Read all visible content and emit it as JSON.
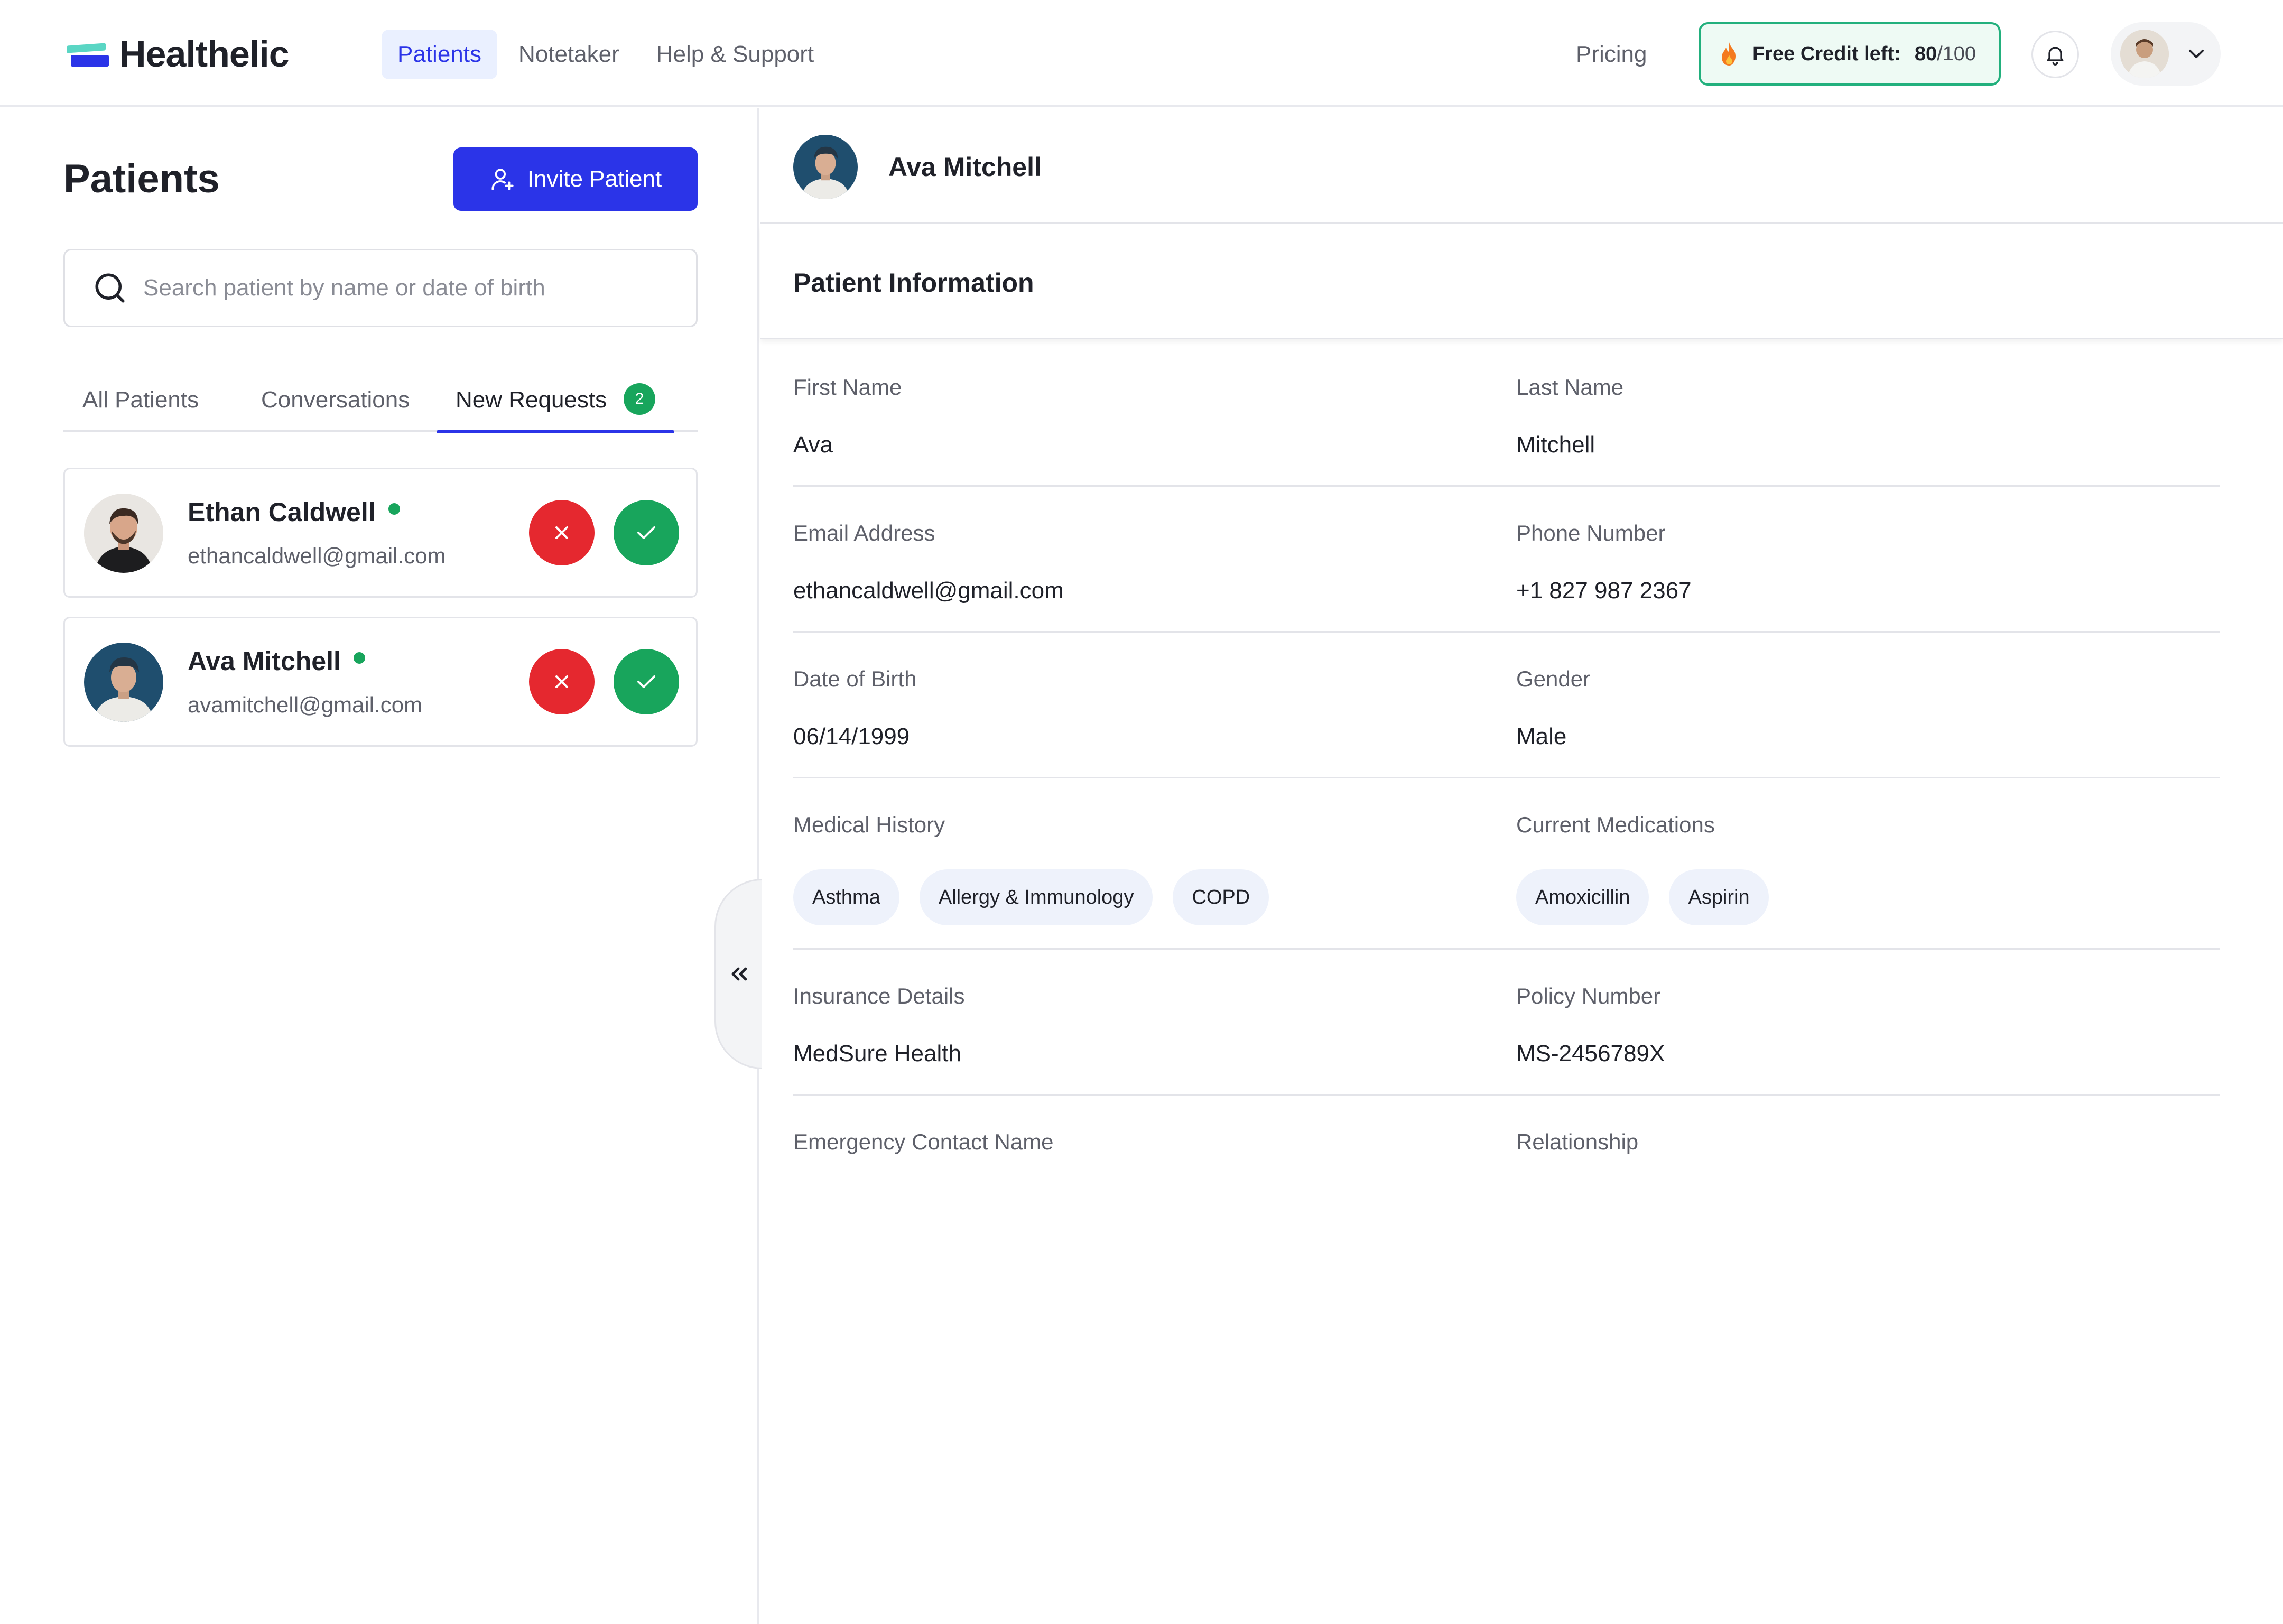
{
  "header": {
    "brand": "Healthelic",
    "nav": [
      {
        "label": "Patients",
        "active": true
      },
      {
        "label": "Notetaker",
        "active": false
      },
      {
        "label": "Help & Support",
        "active": false
      }
    ],
    "pricing": "Pricing",
    "credit": {
      "label": "Free Credit left:",
      "used": "80",
      "total": "/100"
    },
    "icons": {
      "bell": "bell-icon",
      "fire": "fire-icon",
      "chevron": "chevron-down-icon"
    }
  },
  "patients_panel": {
    "title": "Patients",
    "invite_label": "Invite Patient",
    "search_placeholder": "Search patient by name or date of birth",
    "tabs": [
      {
        "label": "All Patients"
      },
      {
        "label": "Conversations"
      },
      {
        "label": "New Requests",
        "badge": "2",
        "active": true
      }
    ],
    "requests": [
      {
        "name": "Ethan Caldwell",
        "email": "ethancaldwell@gmail.com",
        "online": true
      },
      {
        "name": "Ava Mitchell",
        "email": "avamitchell@gmail.com",
        "online": true
      }
    ]
  },
  "detail": {
    "name": "Ava Mitchell",
    "section_title": "Patient Information",
    "fields": {
      "first_name": {
        "label": "First Name",
        "value": "Ava"
      },
      "last_name": {
        "label": "Last Name",
        "value": "Mitchell"
      },
      "email": {
        "label": "Email Address",
        "value": "ethancaldwell@gmail.com"
      },
      "phone": {
        "label": "Phone Number",
        "value": "+1 827 987 2367"
      },
      "dob": {
        "label": "Date of Birth",
        "value": "06/14/1999"
      },
      "gender": {
        "label": "Gender",
        "value": "Male"
      },
      "medical_history": {
        "label": "Medical History",
        "chips": [
          "Asthma",
          "Allergy & Immunology",
          "COPD"
        ]
      },
      "medications": {
        "label": "Current Medications",
        "chips": [
          "Amoxicillin",
          "Aspirin"
        ]
      },
      "insurance": {
        "label": "Insurance Details",
        "value": "MedSure Health"
      },
      "policy": {
        "label": "Policy Number",
        "value": "MS-2456789X"
      },
      "emergency_contact": {
        "label": "Emergency Contact Name"
      },
      "relationship": {
        "label": "Relationship"
      }
    }
  },
  "colors": {
    "accent": "#2b34e8",
    "success": "#18a55c",
    "danger": "#e5282f",
    "credit_border": "#22b07d"
  }
}
